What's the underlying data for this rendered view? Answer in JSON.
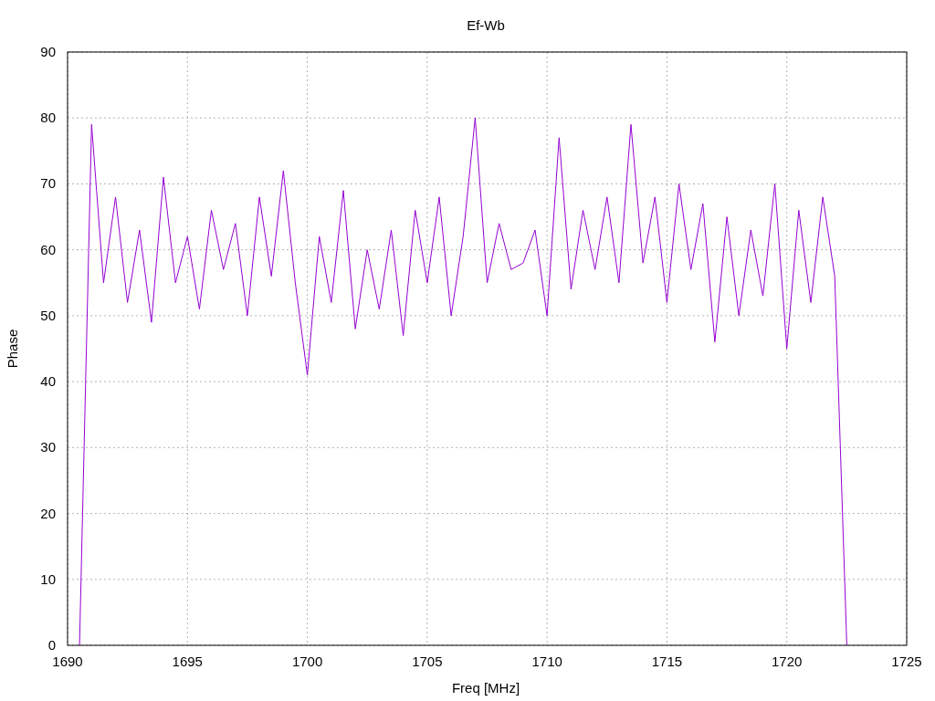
{
  "plot": {
    "chart_data": {
      "type": "line",
      "title": "Ef-Wb",
      "xlabel": "Freq [MHz]",
      "ylabel": "Phase",
      "grid": true,
      "xlim": [
        1690,
        1725
      ],
      "ylim": [
        0,
        90
      ],
      "xticks": [
        1690,
        1695,
        1700,
        1705,
        1710,
        1715,
        1720,
        1725
      ],
      "yticks": [
        90,
        80,
        70,
        60,
        50,
        40,
        30,
        20,
        10,
        0
      ],
      "x": [
        1690.5,
        1691,
        1691.5,
        1692,
        1692.5,
        1693,
        1693.5,
        1694,
        1694.5,
        1695,
        1695.5,
        1696,
        1696.5,
        1697,
        1697.5,
        1698,
        1698.5,
        1699,
        1699.5,
        1700,
        1700.5,
        1701,
        1701.5,
        1702,
        1702.5,
        1703,
        1703.5,
        1704,
        1704.5,
        1705,
        1705.5,
        1706,
        1706.5,
        1707,
        1707.5,
        1708,
        1708.5,
        1709,
        1709.5,
        1710,
        1710.5,
        1711,
        1711.5,
        1712,
        1712.5,
        1713,
        1713.5,
        1714,
        1714.5,
        1715,
        1715.5,
        1716,
        1716.5,
        1717,
        1717.5,
        1718,
        1718.5,
        1719,
        1719.5,
        1720,
        1720.5,
        1721,
        1721.5,
        1722,
        1722.5
      ],
      "series": [
        {
          "color": "#9400d3",
          "values": [
            0,
            79,
            55,
            68,
            52,
            63,
            49,
            71,
            55,
            62,
            51,
            66,
            57,
            64,
            50,
            68,
            56,
            72,
            55,
            41,
            62,
            52,
            69,
            48,
            60,
            51,
            63,
            47,
            66,
            55,
            68,
            50,
            62,
            80,
            55,
            64,
            57,
            58,
            63,
            50,
            77,
            54,
            66,
            57,
            68,
            55,
            79,
            58,
            68,
            52,
            70,
            57,
            67,
            46,
            65,
            50,
            63,
            53,
            70,
            45,
            66,
            52,
            68,
            56,
            0
          ]
        }
      ]
    }
  }
}
